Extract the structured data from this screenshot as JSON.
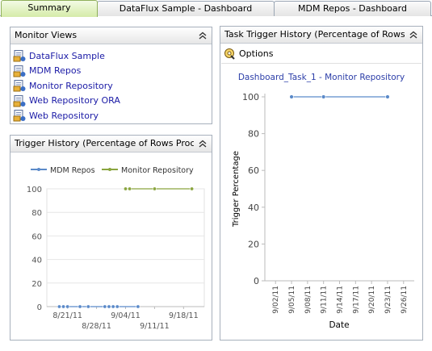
{
  "tabs": [
    {
      "label": "Summary",
      "active": true
    },
    {
      "label": "DataFlux Sample - Dashboard",
      "active": false
    },
    {
      "label": "MDM Repos - Dashboard",
      "active": false
    }
  ],
  "monitor_views": {
    "title": "Monitor Views",
    "items": [
      {
        "label": "DataFlux Sample"
      },
      {
        "label": "MDM Repos"
      },
      {
        "label": "Monitor Repository"
      },
      {
        "label": "Web Repository ORA"
      },
      {
        "label": "Web Repository"
      }
    ]
  },
  "trigger_history": {
    "title": "Trigger History (Percentage of Rows Processed)"
  },
  "task_trigger_history": {
    "title": "Task Trigger History (Percentage of Rows Processed)",
    "options_label": "Options"
  },
  "colors": {
    "accent_tab": "#d5eba8",
    "series_blue": "#5b8ac9",
    "series_green": "#8aa53f",
    "link": "#1a1aa6"
  },
  "chart_data": [
    {
      "type": "line",
      "legend_position": "top",
      "grid": true,
      "ylim": [
        0,
        100
      ],
      "yticks": [
        0,
        20,
        40,
        60,
        80,
        100
      ],
      "x_tick_labels": [
        "8/21/11",
        "8/28/11",
        "9/04/11",
        "9/11/11",
        "9/18/11"
      ],
      "xlabel": "",
      "ylabel": "",
      "series": [
        {
          "name": "MDM Repos",
          "color": "#5b8ac9",
          "x": [
            "8/19/11",
            "8/20/11",
            "8/21/11",
            "8/24/11",
            "8/26/11",
            "8/30/11",
            "8/31/11",
            "9/01/11",
            "9/02/11",
            "9/07/11"
          ],
          "values": [
            0,
            0,
            0,
            0,
            0,
            0,
            0,
            0,
            0,
            0
          ]
        },
        {
          "name": "Monitor Repository",
          "color": "#8aa53f",
          "x": [
            "9/04/11",
            "9/05/11",
            "9/11/11",
            "9/20/11"
          ],
          "values": [
            100,
            100,
            100,
            100
          ]
        }
      ]
    },
    {
      "type": "line",
      "title": "Dashboard_Task_1 - Monitor Repository",
      "xlabel": "Date",
      "ylabel": "Trigger Percentage",
      "grid": false,
      "ylim": [
        0,
        100
      ],
      "yticks": [
        0,
        20,
        40,
        60,
        80,
        100
      ],
      "x_tick_labels": [
        "9/02/11",
        "9/05/11",
        "9/08/11",
        "9/11/11",
        "9/14/11",
        "9/17/11",
        "9/20/11",
        "9/23/11",
        "9/26/11"
      ],
      "series": [
        {
          "color": "#5b8ac9",
          "x": [
            "9/05/11",
            "9/11/11",
            "9/23/11"
          ],
          "values": [
            100,
            100,
            100
          ]
        }
      ]
    }
  ]
}
